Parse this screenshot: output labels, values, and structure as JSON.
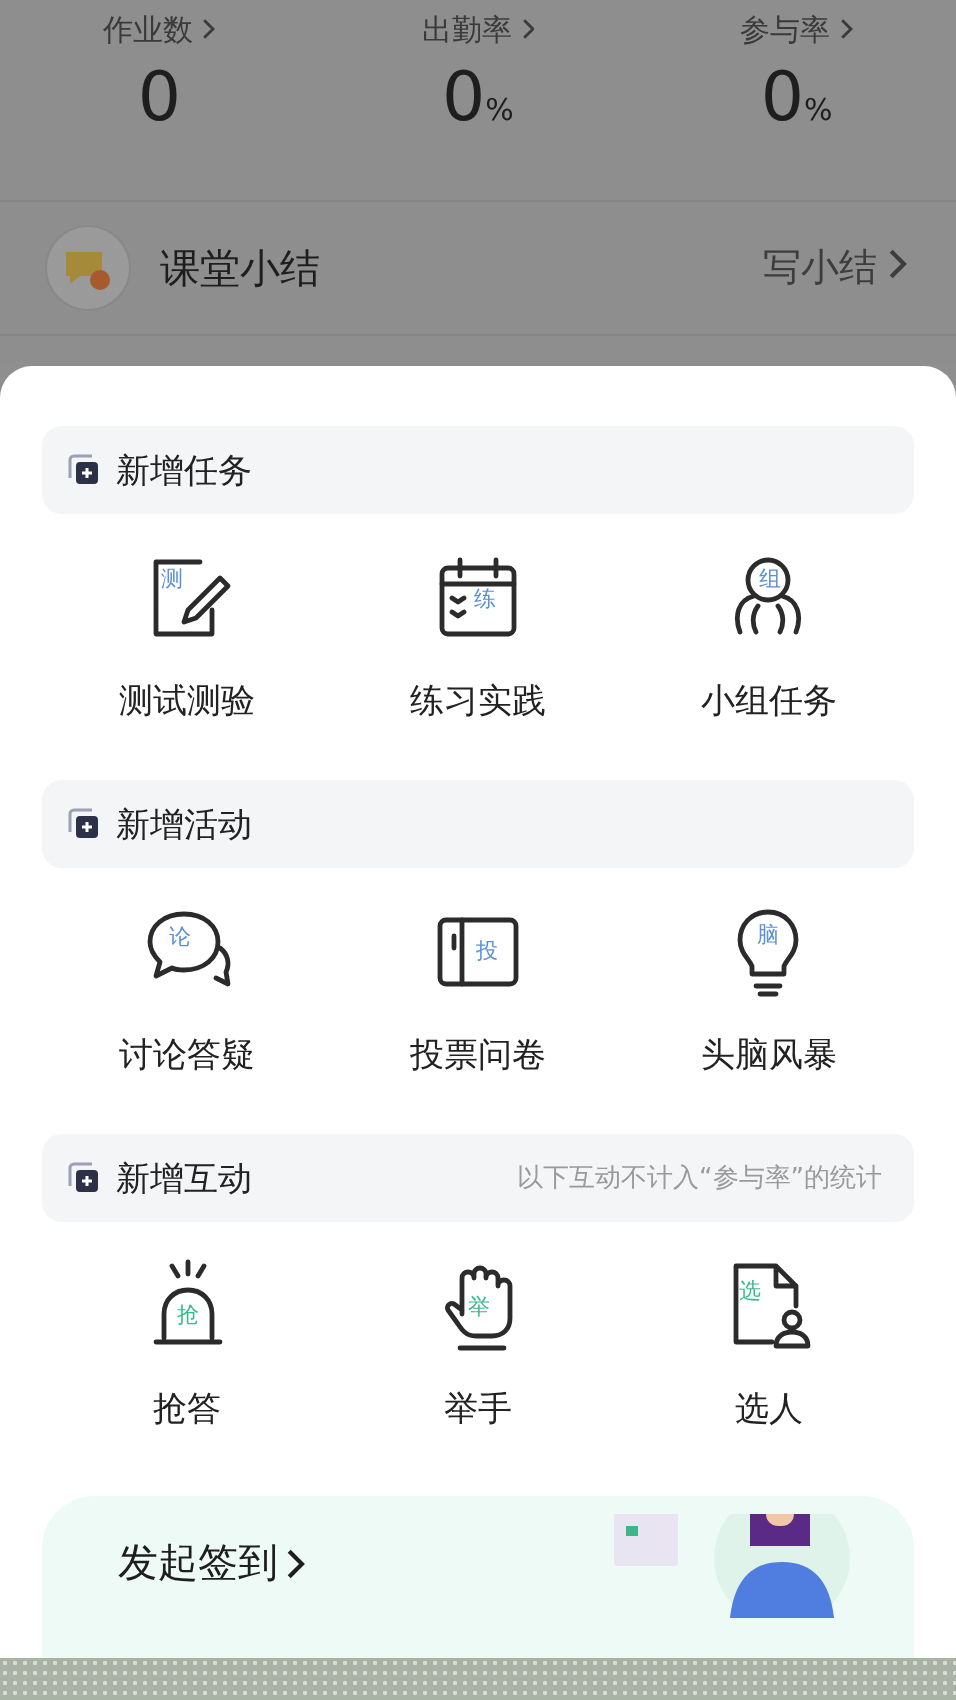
{
  "stats": [
    {
      "label": "作业数",
      "value": "0"
    },
    {
      "label": "出勤率",
      "value": "0",
      "unit": "%"
    },
    {
      "label": "参与率",
      "value": "0",
      "unit": "%"
    }
  ],
  "summary": {
    "title": "课堂小结",
    "action": "写小结"
  },
  "sections": [
    {
      "title": "新增任务",
      "items": [
        {
          "kind": "quiz",
          "glyph": "测",
          "label": "测试测验"
        },
        {
          "kind": "practice",
          "glyph": "练",
          "label": "练习实践"
        },
        {
          "kind": "group",
          "glyph": "组",
          "label": "小组任务"
        }
      ]
    },
    {
      "title": "新增活动",
      "items": [
        {
          "kind": "discussion",
          "glyph": "论",
          "label": "讨论答疑"
        },
        {
          "kind": "vote",
          "glyph": "投",
          "label": "投票问卷"
        },
        {
          "kind": "brainstorm",
          "glyph": "脑",
          "label": "头脑风暴"
        }
      ]
    },
    {
      "title": "新增互动",
      "note": "以下互动不计入“参与率”的统计",
      "items": [
        {
          "kind": "buzzer",
          "glyph": "抢",
          "label": "抢答"
        },
        {
          "kind": "hand",
          "glyph": "举",
          "label": "举手"
        },
        {
          "kind": "pick",
          "glyph": "选",
          "label": "选人"
        }
      ]
    }
  ],
  "checkin": {
    "title": "发起签到"
  }
}
